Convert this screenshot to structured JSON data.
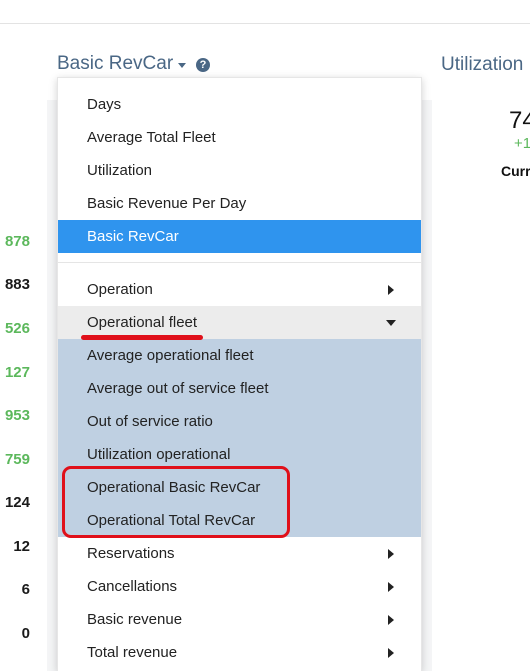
{
  "header": {
    "title": "Basic RevCar",
    "help_glyph": "?"
  },
  "right_panel": {
    "title": "Utilization",
    "value": "74",
    "delta": "+1",
    "label": "Curr"
  },
  "left_values": [
    "878",
    "883",
    "526",
    "127",
    "953",
    "759",
    "124",
    "12",
    "6",
    "0"
  ],
  "left_value_colors": [
    "green",
    "dark",
    "green",
    "green",
    "green",
    "green",
    "dark",
    "dark",
    "dark",
    "dark"
  ],
  "dropdown": {
    "top_items": [
      "Days",
      "Average Total Fleet",
      "Utilization",
      "Basic Revenue Per Day",
      "Basic RevCar"
    ],
    "selected": "Basic RevCar",
    "groups": {
      "operation": "Operation",
      "operational_fleet": "Operational fleet",
      "reservations": "Reservations",
      "cancellations": "Cancellations",
      "basic_revenue": "Basic revenue",
      "total_revenue": "Total revenue"
    },
    "operational_fleet_items": [
      "Average operational fleet",
      "Average out of service fleet",
      "Out of service ratio",
      "Utilization operational",
      "Operational Basic RevCar",
      "Operational Total RevCar"
    ]
  },
  "colors": {
    "accent": "#2f94ee",
    "title": "#4a6785",
    "positive": "#5cb85c",
    "highlight_red": "#e0101a",
    "submenu_bg": "#bfd0e2"
  }
}
